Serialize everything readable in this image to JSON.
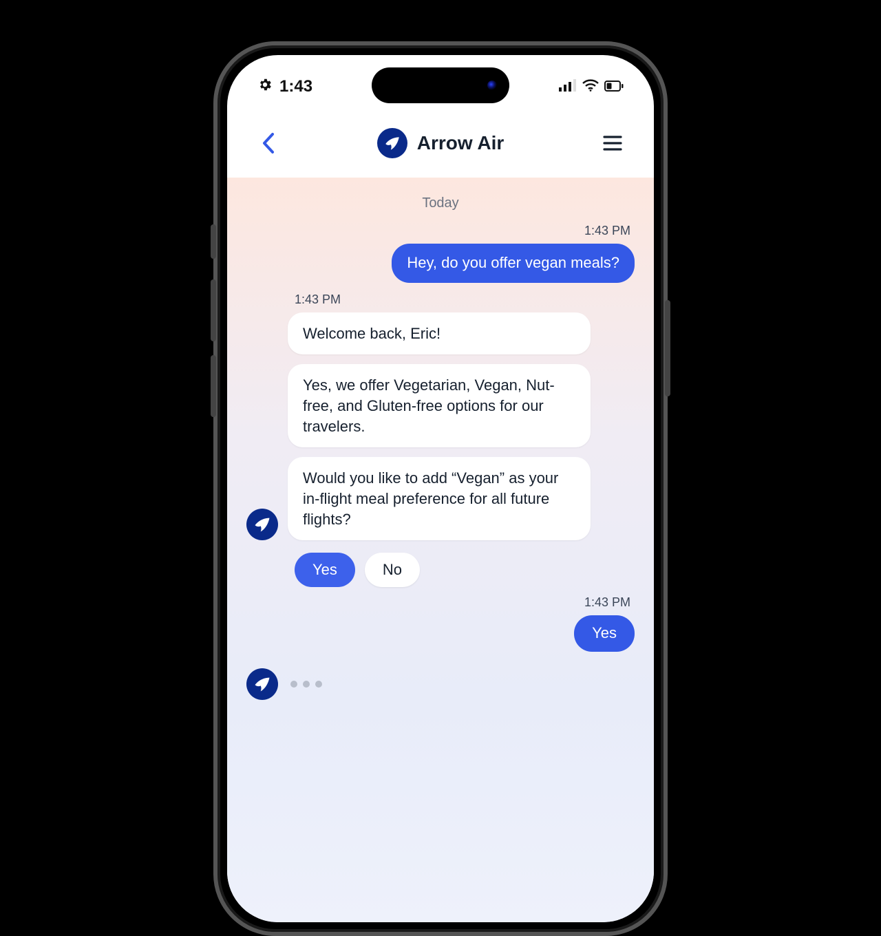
{
  "status": {
    "time": "1:43"
  },
  "header": {
    "title": "Arrow Air"
  },
  "chat": {
    "date_separator": "Today",
    "user1": {
      "ts": "1:43 PM",
      "text": "Hey, do you offer vegan meals?"
    },
    "bot_block": {
      "ts": "1:43 PM",
      "m1": "Welcome back, Eric!",
      "m2": "Yes, we offer Vegetarian, Vegan, Nut-free, and Gluten-free options for our travelers.",
      "m3": "Would you like to add “Vegan” as your in-flight meal preference for all future flights?"
    },
    "quick_replies": {
      "yes": "Yes",
      "no": "No"
    },
    "user2": {
      "ts": "1:43 PM",
      "text": "Yes"
    }
  },
  "colors": {
    "brand_blue": "#3459e6",
    "brand_navy": "#0a2a8a"
  }
}
